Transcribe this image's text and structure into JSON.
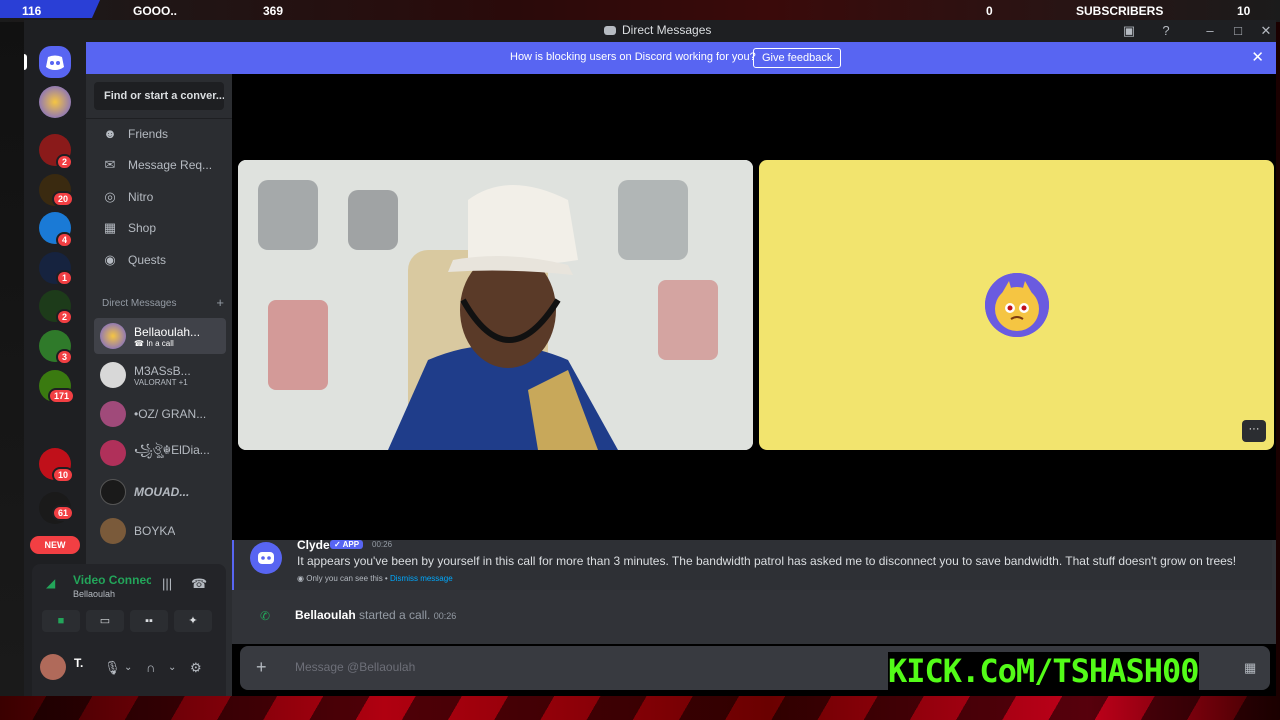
{
  "stream_overlay": {
    "stat1": "116",
    "label1": "GOOO..",
    "stat2": "369",
    "stat3": "0",
    "subscribers_label": "SUBSCRIBERS",
    "subscribers_count": "10"
  },
  "window": {
    "title": "Direct Messages"
  },
  "banner": {
    "text": "How is blocking users on Discord working for you?",
    "button": "Give feedback"
  },
  "server_bar": {
    "badges": [
      "2",
      "20",
      "4",
      "1",
      "2",
      "3",
      "171",
      "10",
      "61"
    ],
    "new_label": "NEW"
  },
  "sidebar": {
    "search_placeholder": "Find or start a conver...",
    "nav": [
      {
        "label": "Friends",
        "icon": "friends-icon"
      },
      {
        "label": "Message Req...",
        "icon": "envelope-icon"
      },
      {
        "label": "Nitro",
        "icon": "nitro-icon"
      },
      {
        "label": "Shop",
        "icon": "shop-icon"
      },
      {
        "label": "Quests",
        "icon": "quests-icon"
      }
    ],
    "dm_header": "Direct Messages",
    "dms": [
      {
        "name": "Bellaoulah...",
        "sub": "In a call",
        "active": true
      },
      {
        "name": "M3ASsB...",
        "sub": "VALORANT +1"
      },
      {
        "name": "•OZ/ GRAN..."
      },
      {
        "name": "꧁ঔৣ☬ElDia..."
      },
      {
        "name": "MOUAD..."
      },
      {
        "name": "BOYKA"
      }
    ]
  },
  "voice": {
    "status": "Video Connec",
    "channel": "Bellaoulah"
  },
  "user_panel": {
    "name": "T."
  },
  "chat": {
    "clyde_name": "Clyde",
    "app_tag": "APP",
    "clyde_time": "00:26",
    "clyde_message": "It appears you've been by yourself in this call for more than 3 minutes. The bandwidth patrol has asked me to disconnect you to save bandwidth. That stuff doesn't grow on trees!",
    "only_you": "Only you can see this •",
    "dismiss": "Dismiss message",
    "call_user": "Bellaoulah",
    "call_text": " started a call. ",
    "call_time": "00:26"
  },
  "composer": {
    "placeholder": "Message @Bellaoulah"
  },
  "overlay_text": "KICK.CoM/TSHASH00",
  "colors": {
    "blurple": "#5865f2",
    "green": "#23a55a",
    "red": "#f23f43",
    "kick": "#53fc18",
    "video_bg": "#f2e46e"
  }
}
